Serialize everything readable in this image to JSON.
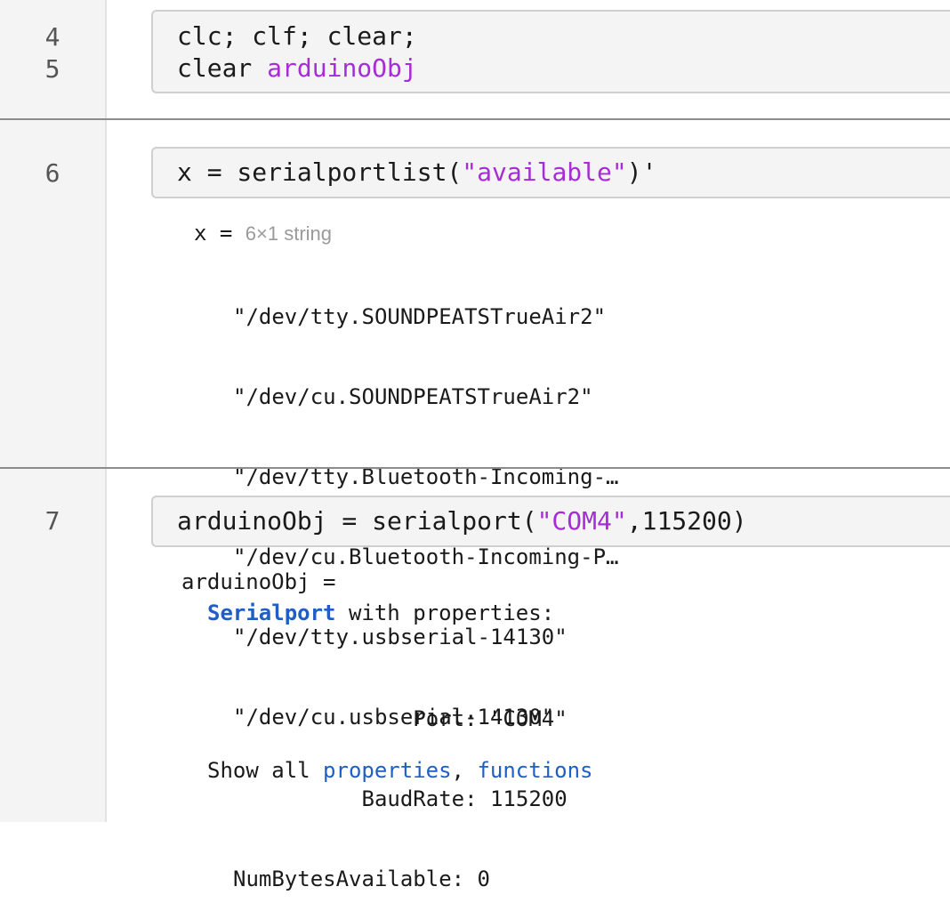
{
  "sections": [
    {
      "line_numbers": [
        "4",
        "5"
      ],
      "code": [
        {
          "text": "clc; clf; clear;"
        },
        {
          "prefix": "clear ",
          "var": "arduinoObj"
        }
      ]
    },
    {
      "line_numbers": [
        "6"
      ],
      "code": {
        "prefix": "x = serialportlist(",
        "string": "\"available\"",
        "suffix": ")'"
      },
      "output": {
        "var_label": "x = ",
        "meta": "6×1 string",
        "values": [
          "\"/dev/tty.SOUNDPEATSTrueAir2\"",
          "\"/dev/cu.SOUNDPEATSTrueAir2\"",
          "\"/dev/tty.Bluetooth-Incoming-…",
          "\"/dev/cu.Bluetooth-Incoming-P…",
          "\"/dev/tty.usbserial-14130\"",
          "\"/dev/cu.usbserial-14130\""
        ]
      }
    },
    {
      "line_numbers": [
        "7"
      ],
      "code": {
        "prefix": "arduinoObj = serialport(",
        "string": "\"COM4\"",
        "suffix": ",115200)"
      },
      "output": {
        "header": "arduinoObj =",
        "class_name": "Serialport",
        "class_suffix": " with properties:",
        "properties": [
          {
            "label": "              Port: ",
            "value": "\"COM4\""
          },
          {
            "label": "          BaudRate: ",
            "value": "115200"
          },
          {
            "label": "NumBytesAvailable: ",
            "value": "0"
          }
        ],
        "show_all": "Show all ",
        "link_properties": "properties",
        "separator": ", ",
        "link_functions": "functions"
      }
    }
  ],
  "colors": {
    "string": "#a72cd6",
    "link": "#1f5fc4",
    "gutter": "#f4f4f4",
    "code_bg": "#f4f4f4"
  }
}
